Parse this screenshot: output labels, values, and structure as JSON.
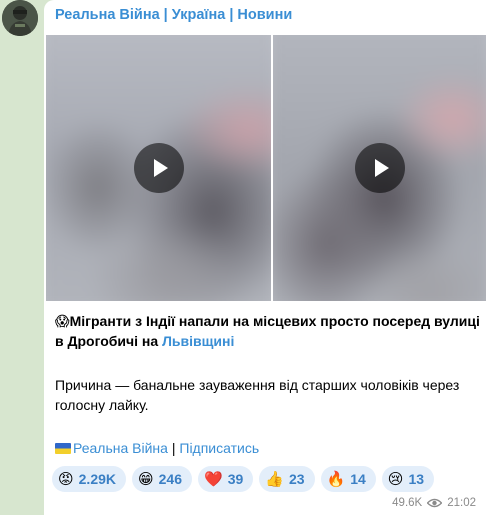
{
  "channel": {
    "name": "Реальна Війна | Україна | Новини"
  },
  "post": {
    "headline_emoji": "😱",
    "headline": "Мігранти з Індії напали на місцевих просто посеред вулиці в Дрогобичі на ",
    "headline_link": "Львівщині",
    "body": "Причина — банальне зауваження від старших чоловіків через голосну лайку.",
    "footer_link": "Реальна Війна",
    "footer_separator": " | ",
    "footer_subscribe": "Підписатись"
  },
  "reactions": [
    {
      "emoji": "😡",
      "icon": "angry-face-icon",
      "count": "2.29K"
    },
    {
      "emoji": "😁",
      "icon": "grinning-face-icon",
      "count": "246"
    },
    {
      "emoji": "❤️",
      "icon": "red-heart-icon",
      "count": "39"
    },
    {
      "emoji": "👍",
      "icon": "thumbs-up-icon",
      "count": "23"
    },
    {
      "emoji": "🔥",
      "icon": "fire-icon",
      "count": "14"
    },
    {
      "emoji": "😢",
      "icon": "crying-face-icon",
      "count": "13"
    }
  ],
  "meta": {
    "views": "49.6K",
    "time": "21:02"
  },
  "colors": {
    "link": "#3a8ed4",
    "reaction_bg": "#e3eefa",
    "chat_bg": "#d7e6cf"
  }
}
